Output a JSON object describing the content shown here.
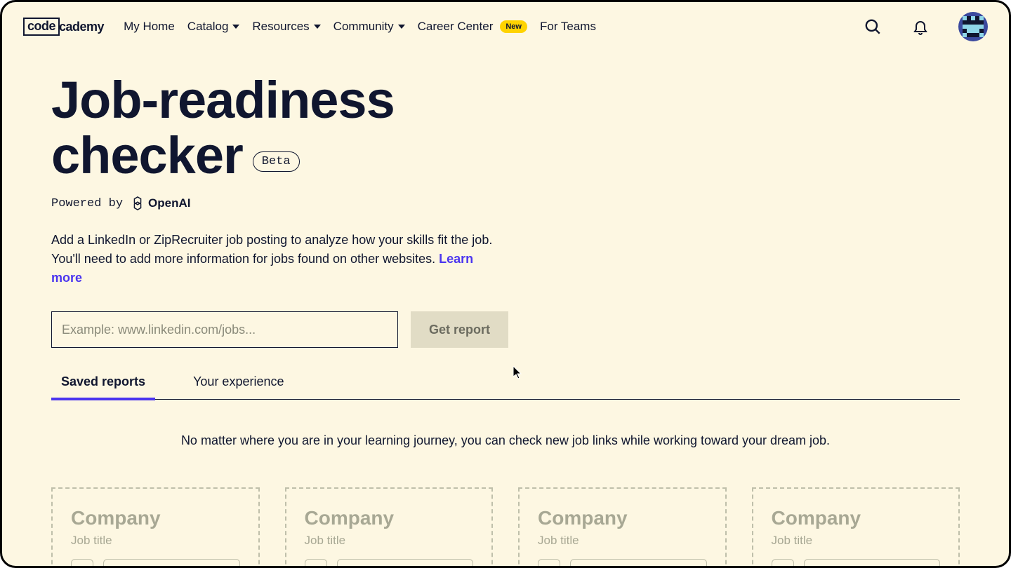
{
  "header": {
    "logo_left": "code",
    "logo_right": "cademy",
    "nav": [
      {
        "label": "My Home",
        "dropdown": false
      },
      {
        "label": "Catalog",
        "dropdown": true
      },
      {
        "label": "Resources",
        "dropdown": true
      },
      {
        "label": "Community",
        "dropdown": true
      },
      {
        "label": "Career Center",
        "dropdown": false,
        "badge": "New"
      },
      {
        "label": "For Teams",
        "dropdown": false
      }
    ]
  },
  "hero": {
    "title_line1": "Job-readiness",
    "title_line2": "checker",
    "beta_label": "Beta",
    "powered_prefix": "Powered by",
    "powered_brand": "OpenAI",
    "description": "Add a LinkedIn or ZipRecruiter job posting to analyze how your skills fit the job. You'll need to add more information for jobs found on other websites. ",
    "learn_more": "Learn more",
    "input_placeholder": "Example: www.linkedin.com/jobs...",
    "get_report": "Get report"
  },
  "tabs": [
    {
      "label": "Saved reports",
      "active": true
    },
    {
      "label": "Your experience",
      "active": false
    }
  ],
  "journey_text": "No matter where you are in your learning journey, you can check new job links while working toward your dream job.",
  "cards": [
    {
      "company": "Company",
      "jobtitle": "Job title"
    },
    {
      "company": "Company",
      "jobtitle": "Job title"
    },
    {
      "company": "Company",
      "jobtitle": "Job title"
    },
    {
      "company": "Company",
      "jobtitle": "Job title"
    }
  ]
}
